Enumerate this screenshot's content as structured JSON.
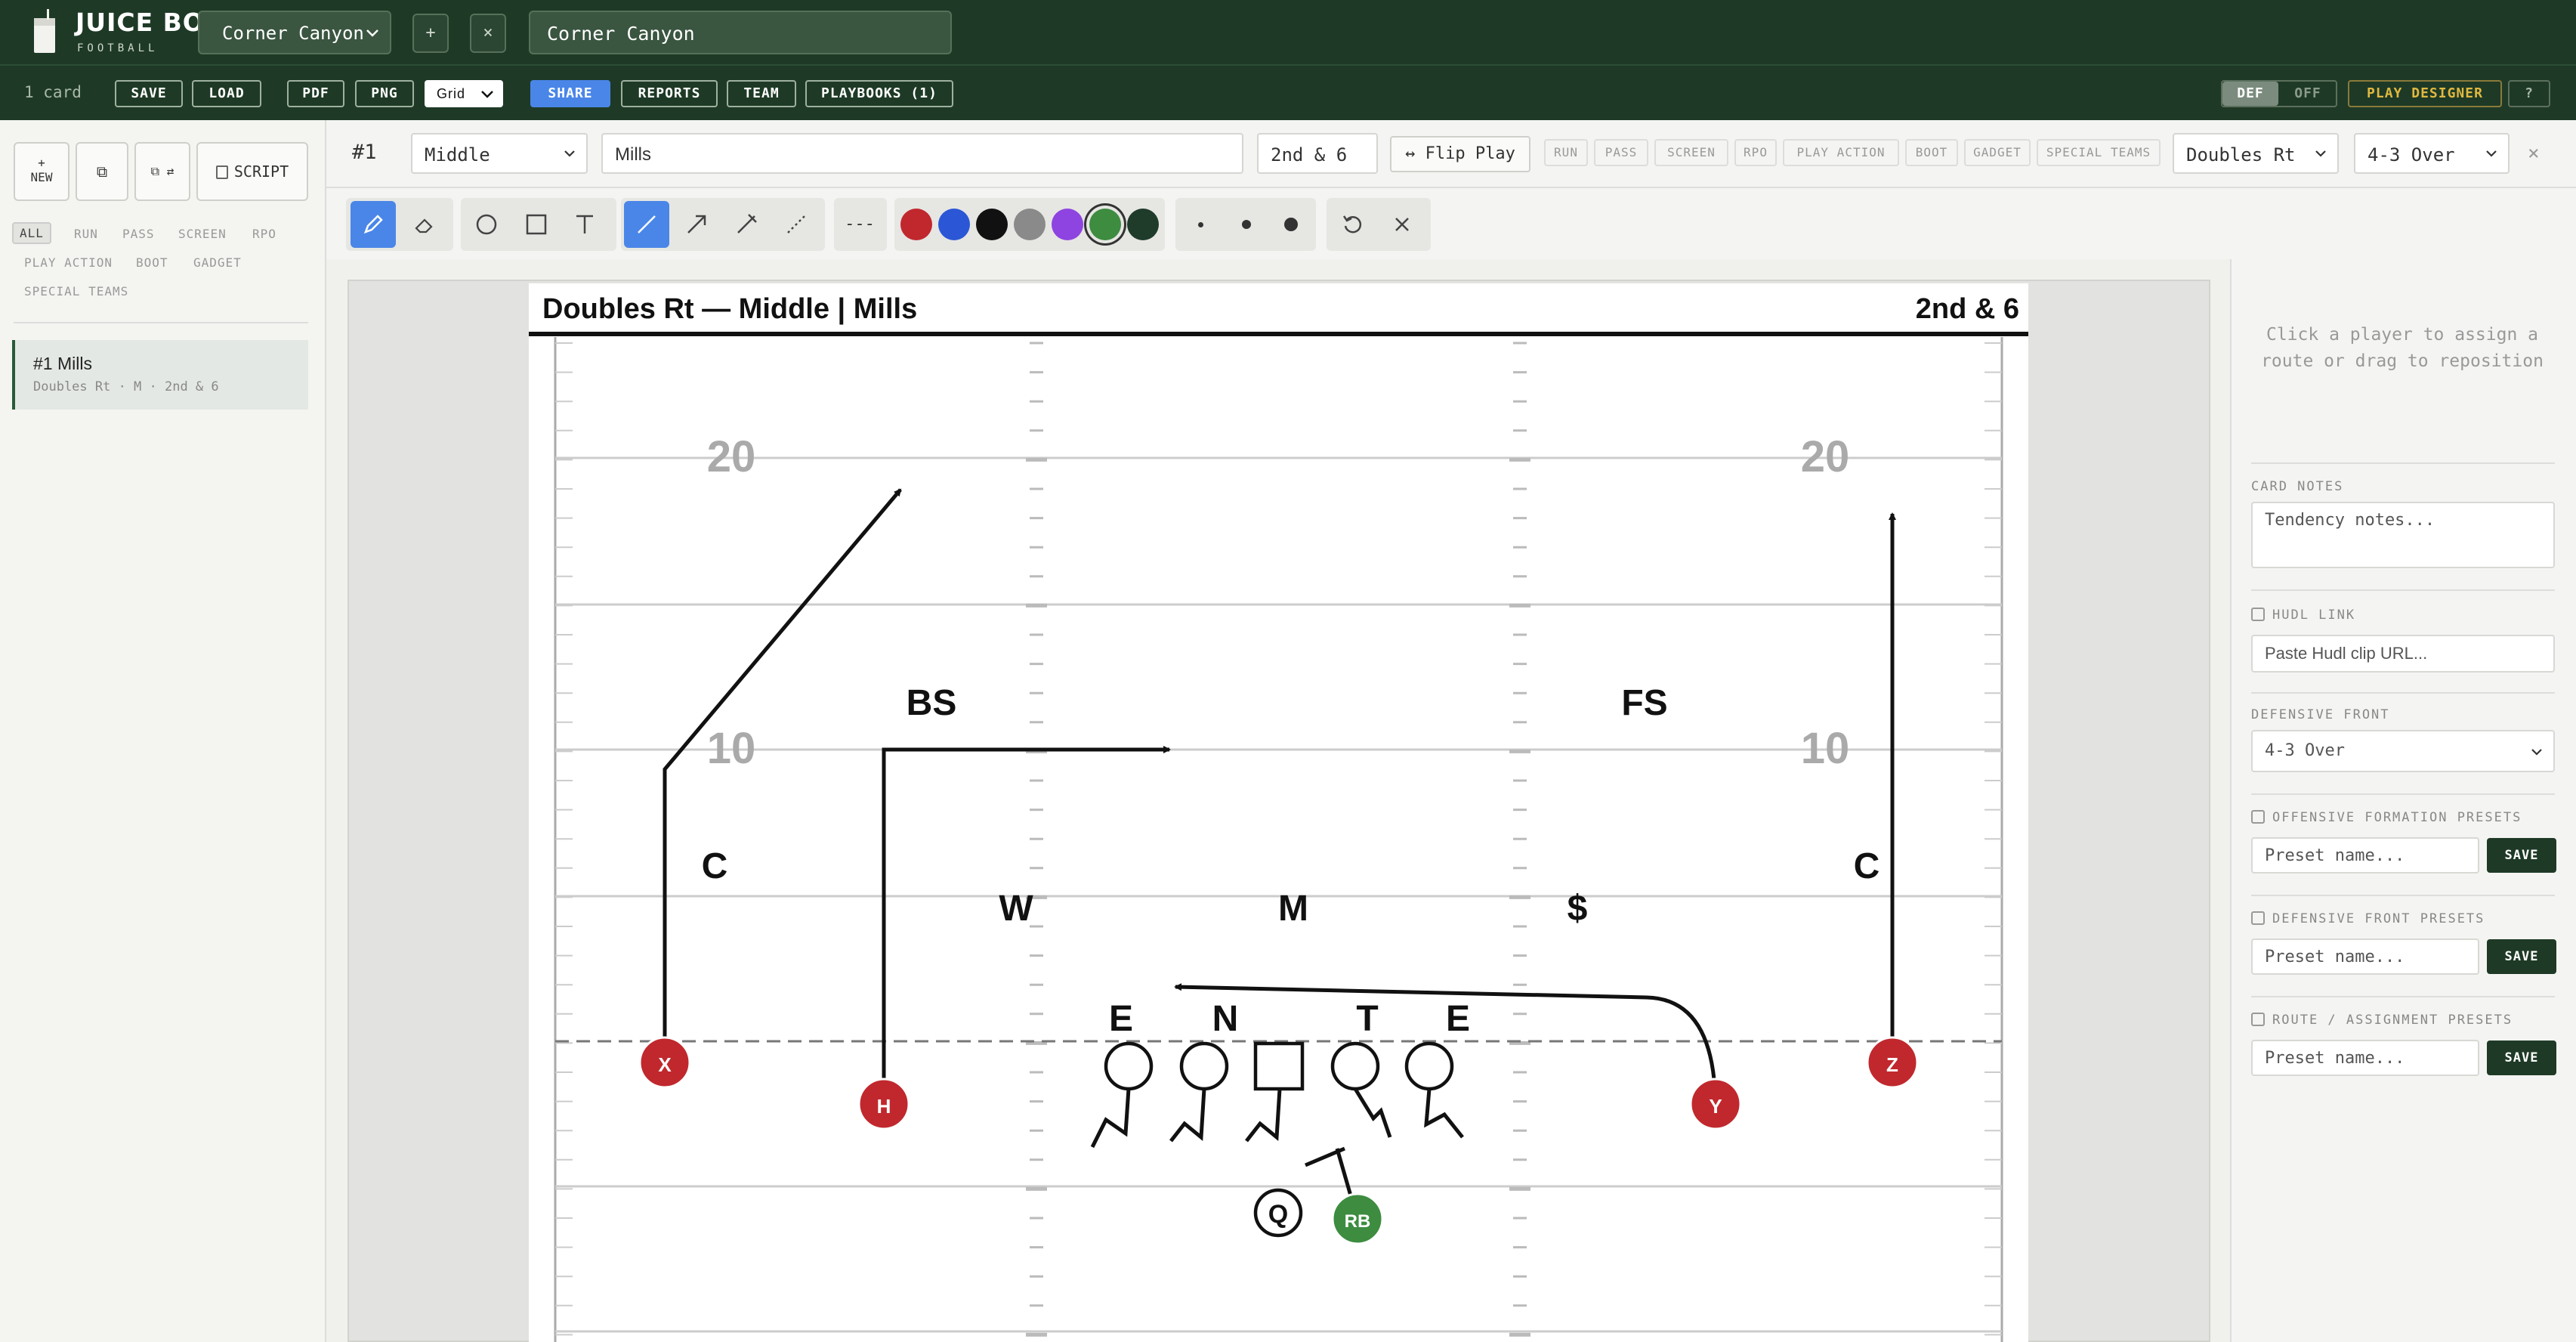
{
  "header": {
    "logo_title": "JUICE BOX",
    "logo_sub": "FOOTBALL",
    "team_select": "Corner Canyon",
    "add_btn": "+",
    "remove_btn": "×",
    "team_name": "Corner Canyon"
  },
  "toolbar": {
    "card_count": "1 card",
    "save": "SAVE",
    "load": "LOAD",
    "pdf": "PDF",
    "png": "PNG",
    "grid": "Grid",
    "share": "SHARE",
    "reports": "REPORTS",
    "team": "TEAM",
    "playbooks": "PLAYBOOKS (1)",
    "def": "DEF",
    "off": "OFF",
    "play_designer": "PLAY DESIGNER",
    "help": "?"
  },
  "sidebar": {
    "new_plus": "+",
    "new_label": "NEW",
    "copy_icon": "⧉",
    "flip_copy_icon": "⧉ ⇄",
    "script_label": "SCRIPT",
    "filters": [
      "ALL",
      "RUN",
      "PASS",
      "SCREEN",
      "RPO",
      "PLAY ACTION",
      "BOOT",
      "GADGET",
      "SPECIAL TEAMS"
    ],
    "cards": [
      {
        "title": "#1 Mills",
        "sub": "Doubles Rt · M · 2nd & 6"
      }
    ]
  },
  "editor": {
    "card_num": "#1",
    "hash": "Middle",
    "play_name": "Mills",
    "down_distance": "2nd & 6",
    "flip_play": "↔ Flip Play",
    "play_types": [
      "RUN",
      "PASS",
      "SCREEN",
      "RPO",
      "PLAY ACTION",
      "BOOT",
      "GADGET",
      "SPECIAL TEAMS"
    ],
    "formation": "Doubles Rt",
    "front": "4-3 Over",
    "close": "×"
  },
  "drawing": {
    "dash_label": "---",
    "colors": [
      "#c0282d",
      "#2b57d6",
      "#111111",
      "#8a8a8a",
      "#8e44e0",
      "#3d8c40",
      "#1f3b2a"
    ],
    "selected_color": "#3d8c40"
  },
  "sheet": {
    "title": "Doubles Rt — Middle | Mills",
    "down_distance": "2nd & 6",
    "yard_labels": [
      "20",
      "20",
      "10",
      "10"
    ],
    "defenders": [
      "BS",
      "FS",
      "C",
      "C",
      "W",
      "M",
      "$",
      "E",
      "N",
      "T",
      "E"
    ],
    "offense": [
      "X",
      "H",
      "Y",
      "Z",
      "RB",
      "Q"
    ],
    "colors": {
      "receiver": "#c0282d",
      "back": "#3d8c40"
    }
  },
  "panel": {
    "hint": "Click a player to assign a route or drag to reposition",
    "card_notes_label": "CARD NOTES",
    "card_notes_placeholder": "Tendency notes...",
    "hudl_label": "HUDL LINK",
    "hudl_placeholder": "Paste Hudl clip URL...",
    "def_front_label": "DEFENSIVE FRONT",
    "def_front_value": "4-3 Over",
    "off_presets_label": "OFFENSIVE FORMATION PRESETS",
    "def_presets_label": "DEFENSIVE FRONT PRESETS",
    "route_presets_label": "ROUTE / ASSIGNMENT PRESETS",
    "preset_placeholder": "Preset name...",
    "save": "SAVE"
  }
}
